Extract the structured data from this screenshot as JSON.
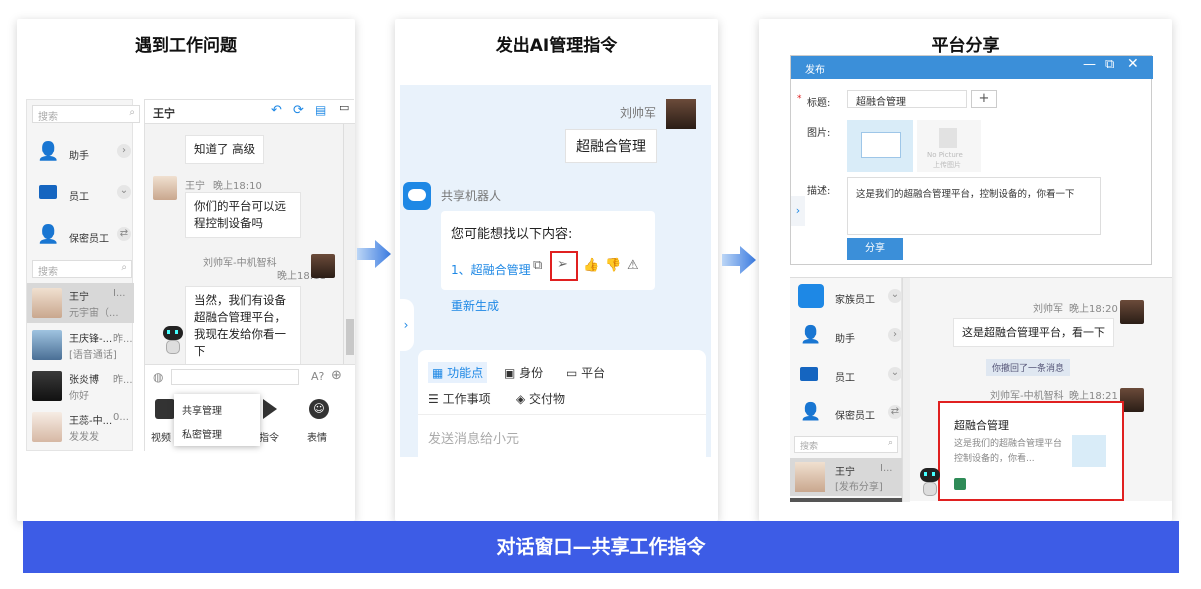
{
  "panel1": {
    "title": "遇到工作问题",
    "search_placeholder": "搜索",
    "chat_title": "王宁",
    "contacts_top": [
      {
        "label": "助手",
        "chev": "›"
      },
      {
        "label": "员工",
        "chev": "⌄"
      },
      {
        "label": "保密员工",
        "chev": "⇄"
      }
    ],
    "search2_placeholder": "搜索",
    "contacts": [
      {
        "name": "王宁",
        "time": "I...",
        "msg": "元宇宙（..."
      },
      {
        "name": "王庆锋-...",
        "time": "昨...",
        "msg": "[语音通话]"
      },
      {
        "name": "张炎博",
        "time": "昨...",
        "msg": "你好"
      },
      {
        "name": "王蕊-中...",
        "time": "0...",
        "msg": "发发发"
      }
    ],
    "msg1": "知道了 高级",
    "sender1": "王宁",
    "time1": "晚上18:10",
    "msg2": "你们的平台可以远程控制设备吗",
    "sender2": "刘帅军-中机智科",
    "time2": "晚上18:11",
    "msg3": "当然，我们有设备超融合管理平台，我现在发给你看一下",
    "toolbar_font": "A?",
    "popup": [
      "共享管理",
      "私密管理"
    ],
    "bottom": [
      "视频",
      "指令",
      "表情"
    ]
  },
  "panel2": {
    "title": "发出AI管理指令",
    "user": "刘帅军",
    "user_msg": "超融合管理",
    "bot_name": "共享机器人",
    "prompt": "您可能想找以下内容:",
    "suggestion": "1、超融合管理",
    "regen": "重新生成",
    "tabs": [
      "功能点",
      "身份",
      "平台"
    ],
    "tabs2": [
      "工作事项",
      "交付物"
    ],
    "input_placeholder": "发送消息给小元"
  },
  "panel3": {
    "title": "平台分享",
    "dialog_title": "发布",
    "label_title": "标题:",
    "title_value": "超融合管理",
    "label_image": "图片:",
    "nopic": "No Picture",
    "upload": "上传图片",
    "label_desc": "描述:",
    "desc": "这是我们的超融合管理平台，控制设备的，你看一下",
    "share_btn": "分享",
    "contacts": [
      {
        "label": "家族员工"
      },
      {
        "label": "助手"
      },
      {
        "label": "员工"
      },
      {
        "label": "保密员工"
      }
    ],
    "search_placeholder": "搜索",
    "contact": {
      "name": "王宁",
      "time": "I...",
      "msg": "[发布分享]"
    },
    "sender1": "刘帅军",
    "time1": "晚上18:20",
    "msg1": "这是超融合管理平台，看一下",
    "recall": "你撤回了一条消息",
    "sender2": "刘帅军-中机智科",
    "time2": "晚上18:21",
    "card_title": "超融合管理",
    "card_desc": "这是我们的超融合管理平台控制设备的，你看..."
  },
  "banner": "对话窗口—共享工作指令",
  "colors": {
    "accent": "#3d5ce6",
    "blue": "#1e88e5",
    "red": "#e02020",
    "dialog": "#3b8fd9"
  }
}
